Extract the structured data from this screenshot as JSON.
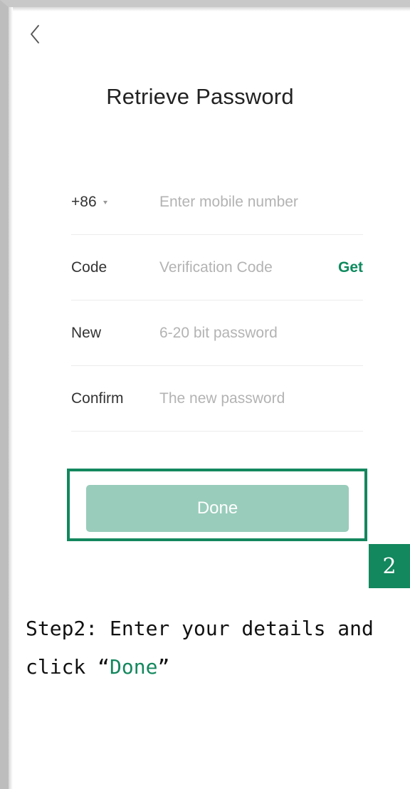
{
  "header": {
    "title": "Retrieve Password"
  },
  "form": {
    "phone": {
      "country_code": "+86",
      "placeholder": "Enter mobile number"
    },
    "code": {
      "label": "Code",
      "placeholder": "Verification Code",
      "get_label": "Get"
    },
    "new_password": {
      "label": "New",
      "placeholder": "6-20 bit password"
    },
    "confirm_password": {
      "label": "Confirm",
      "placeholder": "The new password"
    }
  },
  "actions": {
    "done_label": "Done"
  },
  "annotation": {
    "step_number": "2",
    "caption_prefix": "Step2: Enter your details and click ",
    "caption_open_quote": "“",
    "caption_highlight": "Done",
    "caption_close_quote": "”"
  },
  "colors": {
    "accent": "#13875e",
    "button_disabled": "#99ccbb",
    "placeholder": "#b3b3b3"
  },
  "icons": {
    "back": "chevron-left-icon",
    "country_dropdown": "caret-down-icon"
  }
}
